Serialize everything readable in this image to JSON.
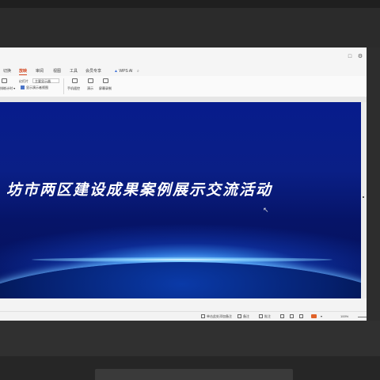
{
  "window": {
    "controls": [
      "□",
      "⚙"
    ]
  },
  "tabs": [
    {
      "label": "切换"
    },
    {
      "label": "放映"
    },
    {
      "label": "审阅"
    },
    {
      "label": "视图"
    },
    {
      "label": "工具"
    },
    {
      "label": "会员专享"
    },
    {
      "label": "WPS AI"
    }
  ],
  "ribbon": {
    "left_label": "排练计时",
    "left_sub": "排练计时 ▾",
    "monitor_label": "幻灯片",
    "monitor_select": "主要显示器",
    "checkbox_label": "显示演示者视图",
    "btn1_label": "手机遥控",
    "btn2_label": "演示",
    "btn3_label": "屏幕录制"
  },
  "slide": {
    "title": "坊市两区建设成果案例展示交流活动"
  },
  "status": {
    "notes_label": "单击此处添加备注",
    "view1": "备注",
    "view2": "批注",
    "zoom": "100%"
  },
  "colors": {
    "accent": "#d2451f",
    "slide_bg": "#071c8c"
  }
}
